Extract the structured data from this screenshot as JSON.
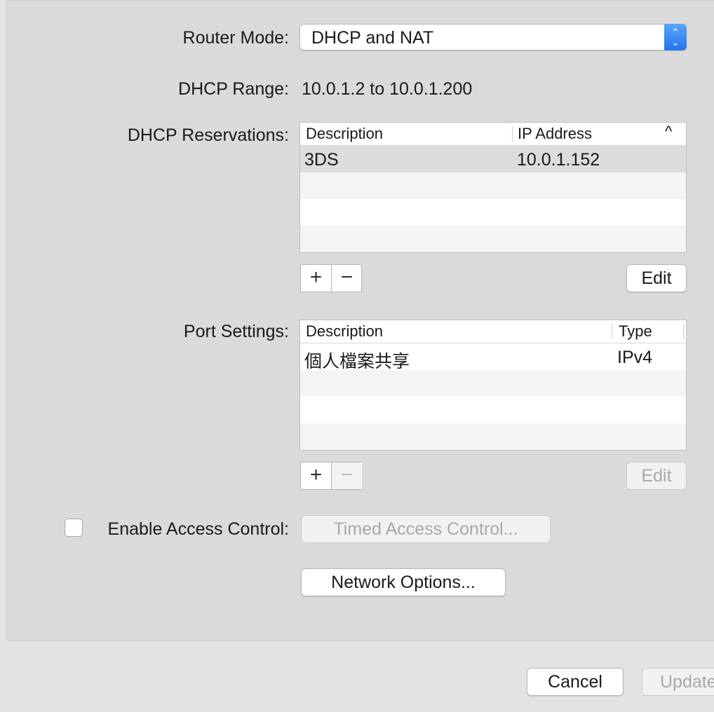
{
  "router_mode": {
    "label": "Router Mode:",
    "value": "DHCP and NAT"
  },
  "dhcp_range": {
    "label": "DHCP Range:",
    "value": "10.0.1.2 to 10.0.1.200"
  },
  "dhcp_reservations": {
    "label": "DHCP Reservations:",
    "columns": [
      "Description",
      "IP Address"
    ],
    "sort_indicator": "^",
    "rows": [
      {
        "description": "3DS",
        "ip": "10.0.1.152"
      }
    ],
    "edit_label": "Edit"
  },
  "port_settings": {
    "label": "Port Settings:",
    "columns": [
      "Description",
      "Type"
    ],
    "rows": [
      {
        "description": "個人檔案共享",
        "type": "IPv4"
      }
    ],
    "edit_label": "Edit"
  },
  "access_control": {
    "label": "Enable Access Control:",
    "checked": false,
    "timed_button": "Timed Access Control..."
  },
  "network_options_button": "Network Options...",
  "footer": {
    "cancel": "Cancel",
    "update": "Update"
  },
  "icons": {
    "add": "+",
    "remove": "−"
  },
  "colors": {
    "accent": "#2a7cf3"
  }
}
